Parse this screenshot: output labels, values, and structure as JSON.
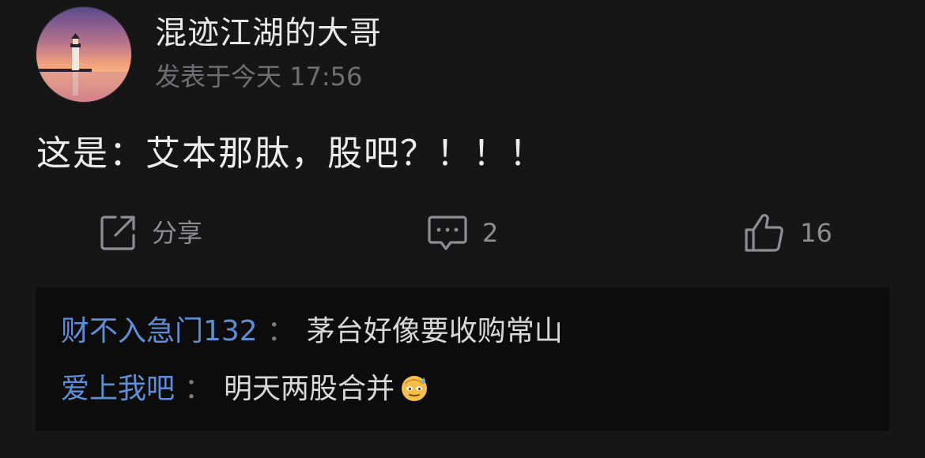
{
  "post": {
    "username": "混迹江湖的大哥",
    "time": "发表于今天 17:56",
    "content": "这是：艾本那肽，股吧？！！！"
  },
  "actions": {
    "share_label": "分享",
    "comment_count": "2",
    "like_count": "16"
  },
  "comments": [
    {
      "user": "财不入急门132",
      "separator": "：",
      "text": "茅台好像要收购常山"
    },
    {
      "user": "爱上我吧",
      "separator": "：",
      "text": "明天两股合并",
      "emoji": "sweat-smile-emoji"
    }
  ],
  "colors": {
    "background": "#161617",
    "comment_box": "#0c0c0d",
    "username_link": "#5d8ed6",
    "muted": "#8e8e92"
  },
  "icons": {
    "share": "share-icon",
    "comment": "comment-icon",
    "like": "thumbs-up-icon"
  }
}
